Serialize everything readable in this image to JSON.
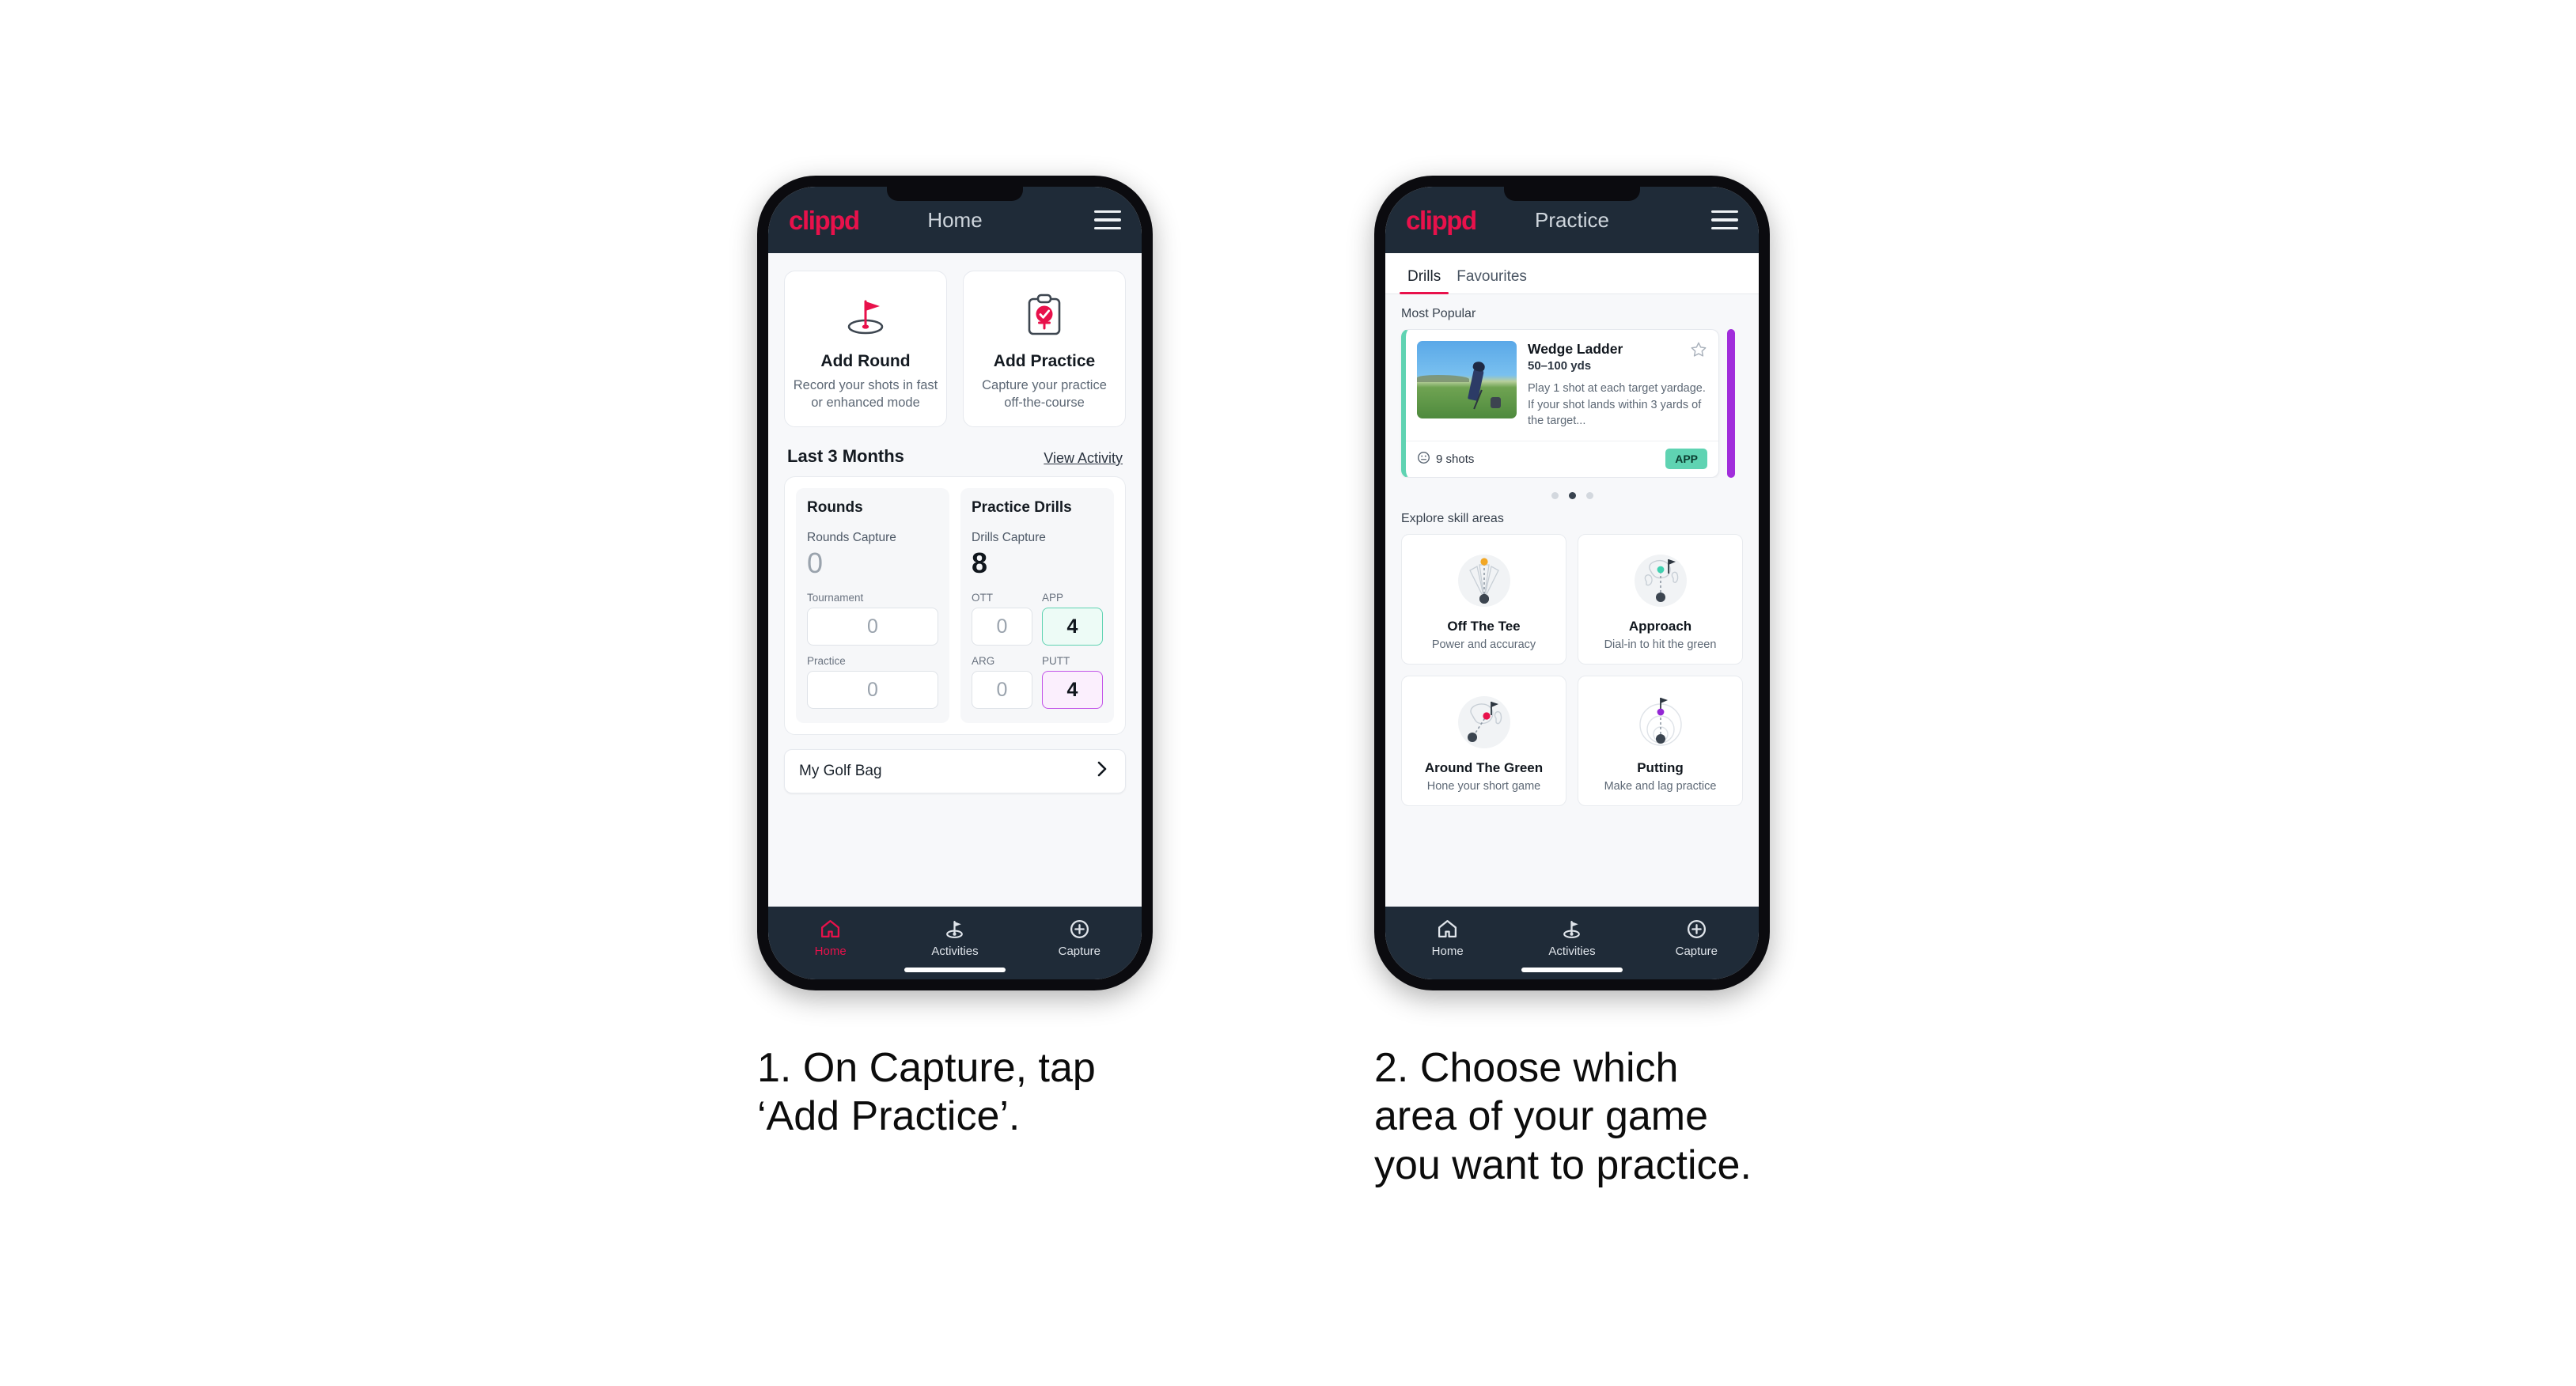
{
  "phone1": {
    "appbar": {
      "logo": "clippd",
      "title": "Home",
      "menu_icon": "hamburger-menu-icon"
    },
    "actions": [
      {
        "icon": "golf-flag-hole-icon",
        "title": "Add Round",
        "subtitle": "Record your shots in fast or enhanced mode"
      },
      {
        "icon": "clipboard-check-tee-icon",
        "title": "Add Practice",
        "subtitle": "Capture your practice off-the-course"
      }
    ],
    "section": {
      "title": "Last 3 Months",
      "link": "View Activity"
    },
    "stats": {
      "rounds": {
        "heading": "Rounds",
        "capture_label": "Rounds Capture",
        "capture_value": "0",
        "items": [
          {
            "label": "Tournament",
            "value": "0",
            "state": "empty"
          },
          {
            "label": "Practice",
            "value": "0",
            "state": "empty"
          }
        ]
      },
      "drills": {
        "heading": "Practice Drills",
        "capture_label": "Drills Capture",
        "capture_value": "8",
        "items": [
          {
            "label": "OTT",
            "value": "0",
            "state": "empty"
          },
          {
            "label": "APP",
            "value": "4",
            "state": "green"
          },
          {
            "label": "ARG",
            "value": "0",
            "state": "empty"
          },
          {
            "label": "PUTT",
            "value": "4",
            "state": "purple"
          }
        ]
      }
    },
    "golf_bag": {
      "label": "My Golf Bag",
      "chevron_icon": "chevron-right-icon"
    },
    "bottom_nav": [
      {
        "label": "Home",
        "icon": "home-icon",
        "active": true
      },
      {
        "label": "Activities",
        "icon": "golf-flag-icon",
        "active": false
      },
      {
        "label": "Capture",
        "icon": "plus-circle-icon",
        "active": false
      }
    ]
  },
  "phone2": {
    "appbar": {
      "logo": "clippd",
      "title": "Practice",
      "menu_icon": "hamburger-menu-icon"
    },
    "tabs": [
      {
        "label": "Drills",
        "active": true
      },
      {
        "label": "Favourites",
        "active": false
      }
    ],
    "most_popular_label": "Most Popular",
    "drill": {
      "title": "Wedge Ladder",
      "subtitle": "50–100 yds",
      "description": "Play 1 shot at each target yardage. If your shot lands within 3 yards of the target...",
      "shots": "9 shots",
      "shots_icon": "clock-icon",
      "badge": "APP",
      "favourite_icon": "star-outline-icon",
      "thumbnail_alt": "golfer-hitting-wedge-photo"
    },
    "carousel_dots": {
      "count": 3,
      "active_index": 1
    },
    "explore_label": "Explore skill areas",
    "skills": [
      {
        "name": "Off The Tee",
        "sub": "Power and accuracy",
        "icon": "tee-dispersion-icon",
        "dot_color": "#f2a724"
      },
      {
        "name": "Approach",
        "sub": "Dial-in to hit the green",
        "icon": "green-approach-icon",
        "dot_color": "#3fd1b0"
      },
      {
        "name": "Around The Green",
        "sub": "Hone your short game",
        "icon": "chip-to-green-icon",
        "dot_color": "#e8114b"
      },
      {
        "name": "Putting",
        "sub": "Make and lag practice",
        "icon": "putting-rings-icon",
        "dot_color": "#9327d4"
      }
    ],
    "bottom_nav": [
      {
        "label": "Home",
        "icon": "home-icon",
        "active": false
      },
      {
        "label": "Activities",
        "icon": "golf-flag-icon",
        "active": false
      },
      {
        "label": "Capture",
        "icon": "plus-circle-icon",
        "active": false
      }
    ]
  },
  "captions": {
    "step1": "1. On Capture, tap\n‘Add Practice’.",
    "step2": "2. Choose which\narea of your game\nyou want to practice."
  },
  "colors": {
    "brand_pink": "#e8114b",
    "header_navy": "#1f2b38",
    "accent_green": "#5fd3b2",
    "accent_purple": "#a12ddb"
  }
}
